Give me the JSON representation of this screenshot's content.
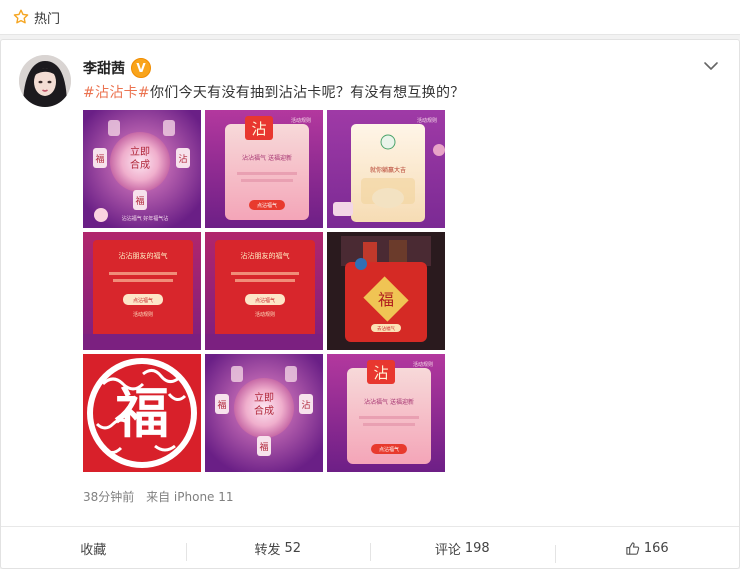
{
  "header": {
    "title": "热门"
  },
  "post": {
    "username": "李甜茜",
    "badge": "V",
    "hashtag": "#沾沾卡#",
    "text": "你们今天有没有抽到沾沾卡呢？有没有想互换的？",
    "time": "38分钟前",
    "source": "来自 iPhone 11",
    "images": [
      {
        "glyphs": [
          "立即",
          "合成",
          "福",
          "沾",
          "福",
          "福"
        ],
        "caption": "沾沾福气 好年福气沾"
      },
      {
        "badge": "沾",
        "heading": "沾沾福气 送福迎新",
        "button": "点沾福气",
        "corner": "活动规则"
      },
      {
        "heading": "就你躺赢大吉",
        "button": "",
        "corner": "活动规则"
      },
      {
        "heading": "沾沾朋友的福气",
        "button": "点沾福气",
        "link": "活动规则"
      },
      {
        "heading": "沾沾朋友的福气",
        "button": "点沾福气",
        "link": "活动规则"
      },
      {
        "glyph": "福",
        "button": "去沾福气"
      },
      {
        "glyph": "福"
      },
      {
        "glyphs": [
          "立即",
          "合成",
          "福",
          "沾",
          "福"
        ]
      },
      {
        "badge": "沾",
        "heading": "沾沾福气 送福迎新",
        "button": "点沾福气",
        "corner": "活动规则"
      }
    ]
  },
  "actions": {
    "favorite": "收藏",
    "repost": "转发",
    "repost_count": "52",
    "comment": "评论",
    "comment_count": "198",
    "like_count": "166"
  },
  "colors": {
    "accent": "#eb7350",
    "badge": "#f9a41b",
    "purple": "#8a2a9e",
    "red": "#d8262c"
  }
}
